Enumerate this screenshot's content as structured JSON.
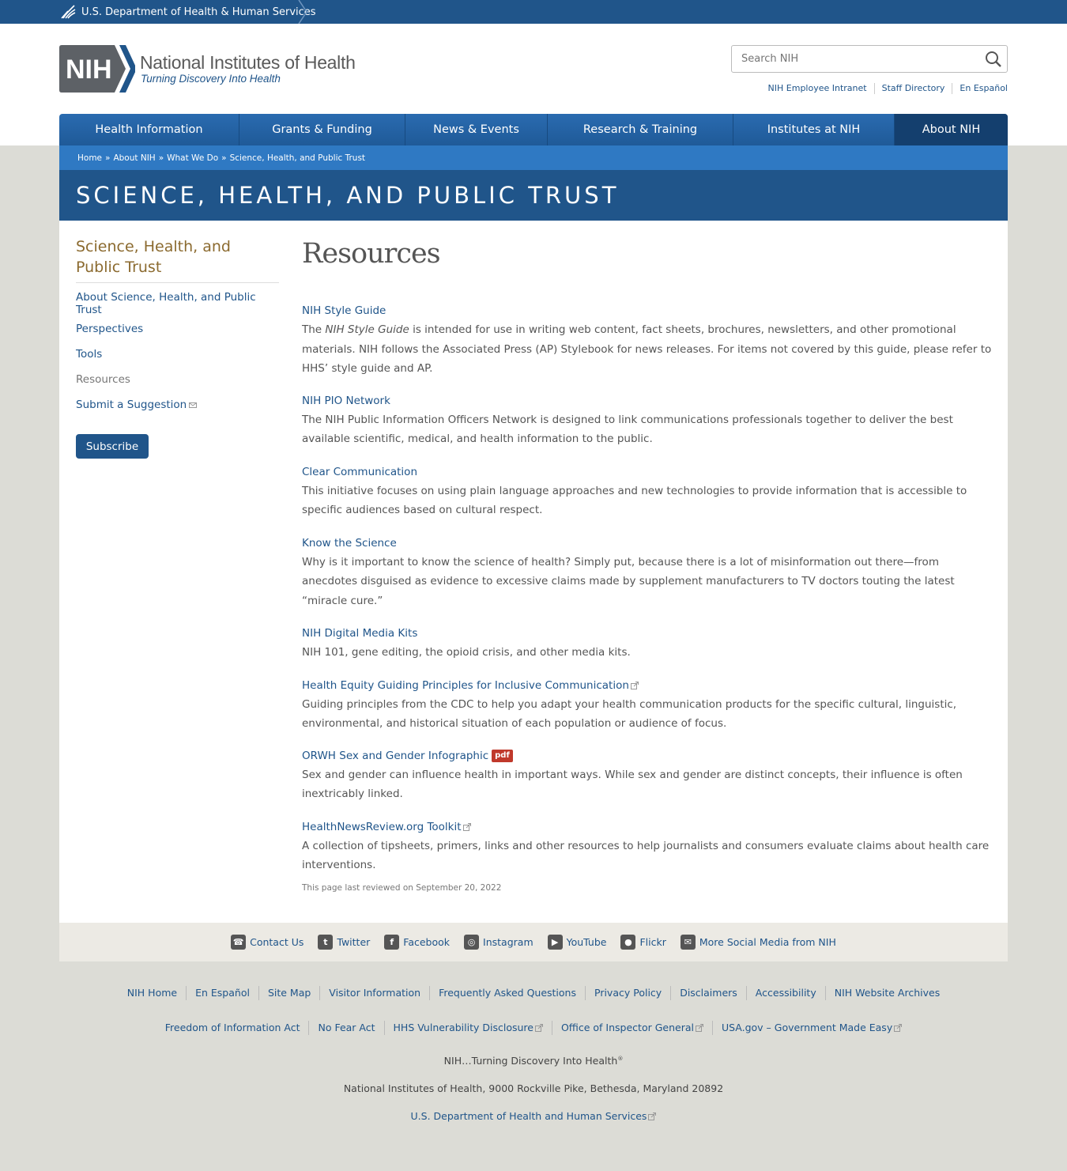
{
  "hhs_bar": {
    "label": "U.S. Department of Health & Human Services"
  },
  "header": {
    "logo_text": "NIH",
    "org_name": "National Institutes of Health",
    "tagline": "Turning Discovery Into Health",
    "search_placeholder": "Search NIH",
    "util_links": [
      "NIH Employee Intranet",
      "Staff Directory",
      "En Español"
    ]
  },
  "nav": [
    "Health Information",
    "Grants & Funding",
    "News & Events",
    "Research & Training",
    "Institutes at NIH",
    "About NIH"
  ],
  "breadcrumb": [
    "Home",
    "About NIH",
    "What We Do",
    "Science, Health, and Public Trust"
  ],
  "banner_title": "SCIENCE, HEALTH, AND PUBLIC TRUST",
  "sidebar": {
    "title": "Science, Health, and Public Trust",
    "items": [
      "About Science, Health, and Public Trust",
      "Perspectives",
      "Tools",
      "Resources",
      "Submit a Suggestion"
    ],
    "subscribe_label": "Subscribe"
  },
  "main": {
    "heading": "Resources",
    "resources": [
      {
        "title": "NIH Style Guide",
        "desc_pre": "The ",
        "desc_em": "NIH Style Guide",
        "desc": " is intended for use in writing web content, fact sheets, brochures, newsletters, and other promotional materials. NIH follows the Associated Press (AP) Stylebook for news releases. For items not covered by this guide, please refer to HHS’ style guide and AP."
      },
      {
        "title": "NIH PIO Network",
        "desc": "The NIH Public Information Officers Network is designed to link communications professionals together to deliver the best available scientific, medical, and health information to the public."
      },
      {
        "title": "Clear Communication",
        "desc": "This initiative focuses on using plain language approaches and new technologies to provide information that is accessible to specific audiences based on cultural respect."
      },
      {
        "title": "Know the Science",
        "desc": "Why is it important to know the science of health? Simply put, because there is a lot of misinformation out there—from anecdotes disguised as evidence to excessive claims made by supplement manufacturers to TV doctors touting the latest “miracle cure.”"
      },
      {
        "title": "NIH Digital Media Kits",
        "desc": "NIH 101, gene editing, the opioid crisis, and other media kits."
      },
      {
        "title": "Health Equity Guiding Principles for Inclusive Communication",
        "desc": "Guiding principles from the CDC to help you adapt your health communication products for the specific cultural, linguistic, environmental, and historical situation of each population or audience of focus."
      },
      {
        "title": "ORWH Sex and Gender Infographic",
        "badge": "pdf",
        "desc": "Sex and gender can influence health in important ways. While sex and gender are distinct concepts, their influence is often inextricably linked."
      },
      {
        "title": "HealthNewsReview.org Toolkit",
        "desc": "A collection of tipsheets, primers, links and other resources to help journalists and consumers evaluate claims about health care interventions."
      }
    ],
    "reviewed": "This page last reviewed on September 20, 2022"
  },
  "social": [
    "Contact Us",
    "Twitter",
    "Facebook",
    "Instagram",
    "YouTube",
    "Flickr",
    "More Social Media from NIH"
  ],
  "footer": {
    "row1": [
      "NIH Home",
      "En Español",
      "Site Map",
      "Visitor Information",
      "Frequently Asked Questions",
      "Privacy Policy",
      "Disclaimers",
      "Accessibility",
      "NIH Website Archives"
    ],
    "row2": [
      "Freedom of Information Act",
      "No Fear Act",
      "HHS Vulnerability Disclosure",
      "Office of Inspector General",
      "USA.gov – Government Made Easy"
    ],
    "tagline": "NIH…Turning Discovery Into Health",
    "tagline_mark": "®",
    "address": "National Institutes of Health, 9000 Rockville Pike, Bethesda, Maryland 20892",
    "hhs_link": "U.S. Department of Health and Human Services"
  },
  "colors": {
    "brand_blue": "#20558a",
    "accent_gold": "#8b6a2f",
    "pdf_red": "#c0392b"
  }
}
